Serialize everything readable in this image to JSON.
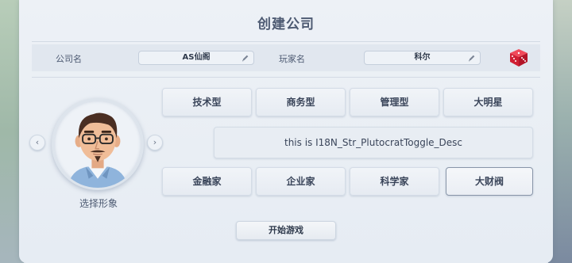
{
  "header": {
    "title": "创建公司"
  },
  "company": {
    "label": "公司名",
    "value": "AS仙阁"
  },
  "player": {
    "label": "玩家名",
    "value": "科尔"
  },
  "avatar": {
    "label": "选择形象",
    "prev_arrow": "‹",
    "next_arrow": "›"
  },
  "styles": [
    {
      "label": "技术型"
    },
    {
      "label": "商务型"
    },
    {
      "label": "管理型"
    },
    {
      "label": "大明星"
    }
  ],
  "description": "this is I18N_Str_PlutocratToggle_Desc",
  "roles": [
    {
      "label": "金融家",
      "selected": false
    },
    {
      "label": "企业家",
      "selected": false
    },
    {
      "label": "科学家",
      "selected": false
    },
    {
      "label": "大财阀",
      "selected": true
    }
  ],
  "start_button": "开始游戏",
  "icons": {
    "edit": "pencil-icon",
    "dice": "dice-icon"
  },
  "colors": {
    "accent": "#4d5a72",
    "dice_red": "#e0263a",
    "selected_border": "#8895a8"
  }
}
